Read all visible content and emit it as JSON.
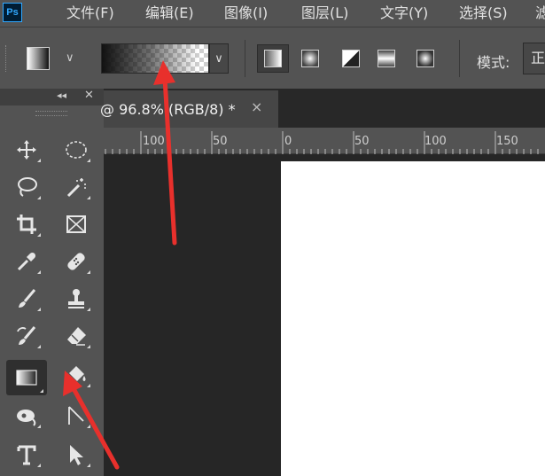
{
  "app": {
    "logo": "Ps"
  },
  "menu": [
    "文件(F)",
    "编辑(E)",
    "图像(I)",
    "图层(L)",
    "文字(Y)",
    "选择(S)",
    "滤"
  ],
  "options": {
    "tool_preset_icon": "gradient-tool-preset-icon",
    "gradient_preview": "black-to-transparent",
    "gradient_types": [
      "linear",
      "radial",
      "angle",
      "reflected",
      "diamond"
    ],
    "active_gradient_type": "linear",
    "mode_label": "模式:",
    "mode_value": "正"
  },
  "toolbar": {
    "collapse_glyph": "◂◂",
    "close_glyph": "✕",
    "tools": [
      {
        "id": "move",
        "icon": "move-icon"
      },
      {
        "id": "ellipse-marquee",
        "icon": "ellipse-marquee-icon"
      },
      {
        "id": "lasso",
        "icon": "lasso-icon"
      },
      {
        "id": "magic-wand",
        "icon": "magic-wand-icon"
      },
      {
        "id": "crop",
        "icon": "crop-icon"
      },
      {
        "id": "frame",
        "icon": "frame-icon"
      },
      {
        "id": "eyedropper",
        "icon": "eyedropper-icon"
      },
      {
        "id": "healing-brush",
        "icon": "healing-brush-icon"
      },
      {
        "id": "brush",
        "icon": "brush-icon"
      },
      {
        "id": "clone-stamp",
        "icon": "clone-stamp-icon"
      },
      {
        "id": "history-brush",
        "icon": "history-brush-icon"
      },
      {
        "id": "eraser",
        "icon": "eraser-icon"
      },
      {
        "id": "gradient",
        "icon": "gradient-icon",
        "active": true
      },
      {
        "id": "paint-bucket",
        "icon": "paint-bucket-icon"
      },
      {
        "id": "blur",
        "icon": "blur-icon"
      },
      {
        "id": "pen",
        "icon": "pen-icon"
      },
      {
        "id": "type",
        "icon": "type-icon"
      },
      {
        "id": "path-selection",
        "icon": "path-selection-icon"
      }
    ]
  },
  "document": {
    "tab_title": "@ 96.8% (RGB/8) *",
    "close_glyph": "×"
  },
  "ruler": {
    "labels": [
      "100",
      "50",
      "0",
      "50",
      "100",
      "150"
    ]
  },
  "colors": {
    "panel": "#535353",
    "workspace": "#262626",
    "annotation_arrow": "#e8302c"
  }
}
